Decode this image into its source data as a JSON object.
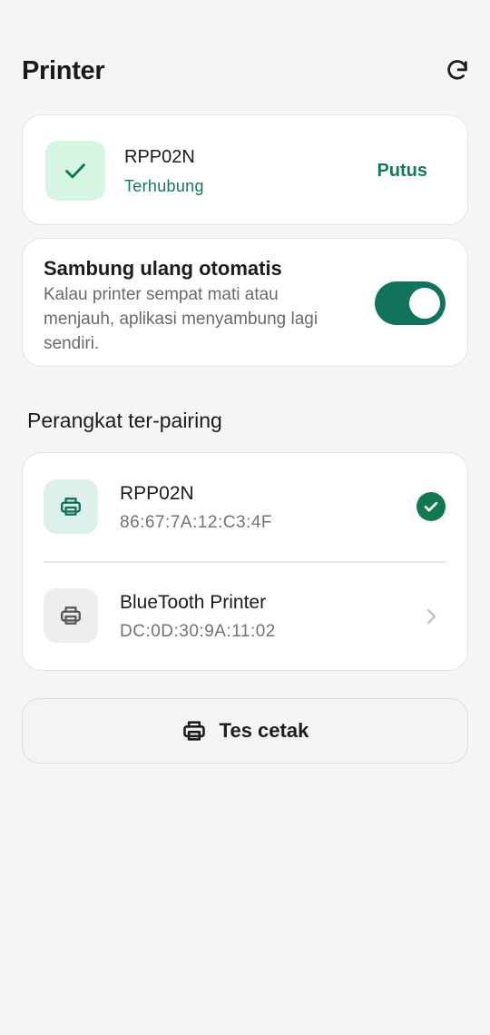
{
  "header": {
    "title": "Printer",
    "refresh_icon": "refresh-icon"
  },
  "connected": {
    "name": "RPP02N",
    "status": "Terhubung",
    "disconnect_label": "Putus",
    "icon": "check-icon",
    "accent": "#14785a"
  },
  "auto_reconnect": {
    "title": "Sambung ulang otomatis",
    "description": "Kalau printer sempat mati atau menjauh, aplikasi menyambung lagi sendiri.",
    "enabled": true,
    "toggle_color": "#12735d"
  },
  "paired": {
    "title": "Perangkat ter-pairing",
    "devices": [
      {
        "name": "RPP02N",
        "mac": "86:67:7A:12:C3:4F",
        "selected": true,
        "icon": "printer-icon"
      },
      {
        "name": "BlueTooth Printer",
        "mac": "DC:0D:30:9A:11:02",
        "selected": false,
        "icon": "printer-icon"
      }
    ]
  },
  "test_print": {
    "label": "Tes cetak",
    "icon": "printer-icon"
  }
}
